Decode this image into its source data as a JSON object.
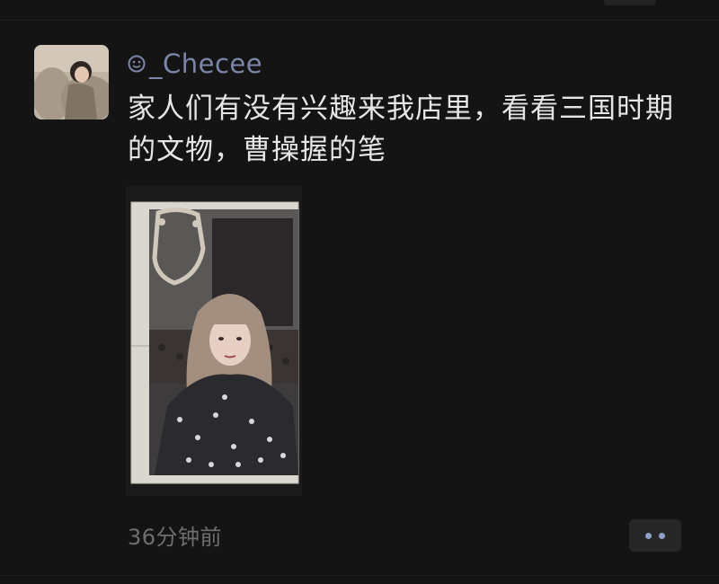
{
  "post": {
    "username": "_Checee",
    "username_prefix_icon": "smiley-icon",
    "text": "家人们有没有兴趣来我店里，看看三国时期的文物，曹操握的笔",
    "timestamp": "36分钟前",
    "more_icon": "more-dots-icon"
  },
  "colors": {
    "background": "#141414",
    "username": "#7b86a8",
    "text": "#e6e6e6",
    "timestamp": "#6e6e6e",
    "more_button_bg": "#262626",
    "more_dots": "#8fa0c6"
  }
}
